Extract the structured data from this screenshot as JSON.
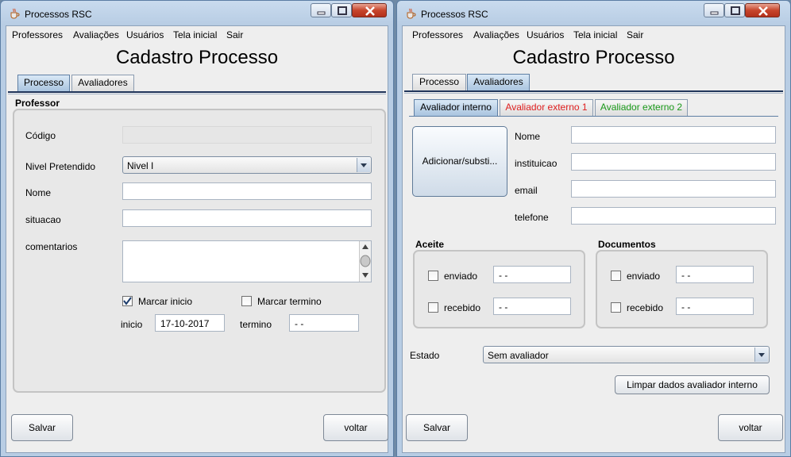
{
  "window_a": {
    "title": "Processos RSC",
    "menu": [
      "Professores",
      "Avaliações",
      "Usuários",
      "Tela inicial",
      "Sair"
    ],
    "form_title": "Cadastro Processo",
    "tabs": [
      "Processo",
      "Avaliadores"
    ],
    "active_tab": "Processo",
    "section_title": "Professor",
    "codigo_label": "Código",
    "codigo_value": "",
    "nivel_label": "Nivel Pretendido",
    "nivel_value": "Nivel I",
    "nome_label": "Nome",
    "nome_value": "",
    "situacao_label": "situacao",
    "situacao_value": "",
    "comentarios_label": "comentarios",
    "comentarios_value": "",
    "marcar_inicio_label": "Marcar inicio",
    "marcar_inicio_checked": true,
    "marcar_termino_label": "Marcar termino",
    "marcar_termino_checked": false,
    "inicio_label": "inicio",
    "inicio_value": "17-10-2017",
    "termino_label": "termino",
    "termino_value": "- -",
    "salvar_label": "Salvar",
    "voltar_label": "voltar"
  },
  "window_b": {
    "title": "Processos RSC",
    "menu": [
      "Professores",
      "Avaliações",
      "Usuários",
      "Tela inicial",
      "Sair"
    ],
    "form_title": "Cadastro Processo",
    "tabs": [
      "Processo",
      "Avaliadores"
    ],
    "active_tab": "Avaliadores",
    "subtabs": [
      "Avaliador interno",
      "Avaliador externo 1",
      "Avaliador externo 2"
    ],
    "subtab_colors": [
      "#000000",
      "#e02020",
      "#1a9a1a"
    ],
    "active_subtab": "Avaliador interno",
    "add_button_label": "Adicionar/substi...",
    "nome_label": "Nome",
    "nome_value": "",
    "instituicao_label": "instituicao",
    "instituicao_value": "",
    "email_label": "email",
    "email_value": "",
    "telefone_label": "telefone",
    "telefone_value": "",
    "aceite": {
      "title": "Aceite",
      "enviado_label": "enviado",
      "enviado_checked": false,
      "enviado_value": "- -",
      "recebido_label": "recebido",
      "recebido_checked": false,
      "recebido_value": "- -"
    },
    "documentos": {
      "title": "Documentos",
      "enviado_label": "enviado",
      "enviado_checked": false,
      "enviado_value": "- -",
      "recebido_label": "recebido",
      "recebido_checked": false,
      "recebido_value": "- -"
    },
    "estado_label": "Estado",
    "estado_value": "Sem avaliador",
    "limpar_label": "Limpar dados avaliador interno",
    "salvar_label": "Salvar",
    "voltar_label": "voltar"
  },
  "icons": {
    "app": "java-cup-icon",
    "minimize": "minimize-icon",
    "maximize": "maximize-icon",
    "close": "close-icon"
  }
}
